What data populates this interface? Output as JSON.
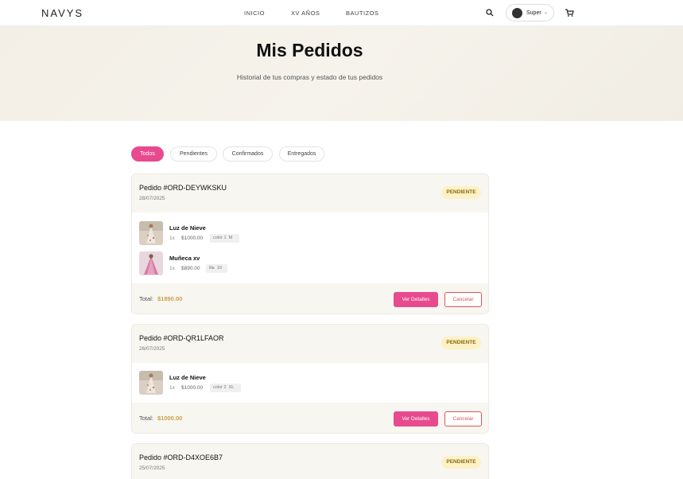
{
  "header": {
    "logo": "NAVYS",
    "logo_extra": "ꟷᵀ ꟷᵀ",
    "nav": [
      {
        "label": "INICIO"
      },
      {
        "label": "XV AÑOS"
      },
      {
        "label": "BAUTIZOS"
      }
    ],
    "user_name": "Super",
    "search_icon": "search-icon",
    "cart_icon": "cart-icon"
  },
  "hero": {
    "title": "Mis Pedidos",
    "subtitle": "Historial de tus compras y estado de tus pedidos"
  },
  "filters": [
    {
      "label": "Todos",
      "active": true
    },
    {
      "label": "Pendientes",
      "active": false
    },
    {
      "label": "Confirmados",
      "active": false
    },
    {
      "label": "Entregados",
      "active": false
    }
  ],
  "colors": {
    "accent": "#e84a8e",
    "badge_bg": "#fdf1c6",
    "badge_text": "#8a6a11",
    "total": "#caa049",
    "cancel": "#e0545a"
  },
  "total_label": "Total:",
  "details_label": "Ver Detalles",
  "cancel_label": "Cancelar",
  "orders": [
    {
      "id": "Pedido #ORD-DEYWKSKU",
      "date": "28/07/2025",
      "status": "PENDIENTE",
      "total": "$1890.00",
      "items": [
        {
          "name": "Luz de Nieve",
          "qty": "1x",
          "price": "$1000.00",
          "color": "color 1",
          "size": "M"
        },
        {
          "name": "Muñeca xv",
          "qty": "1x",
          "price": "$890.00",
          "color": "lila",
          "size": "10"
        }
      ]
    },
    {
      "id": "Pedido #ORD-QR1LFAOR",
      "date": "26/07/2025",
      "status": "PENDIENTE",
      "total": "$1000.00",
      "items": [
        {
          "name": "Luz de Nieve",
          "qty": "1x",
          "price": "$1000.00",
          "color": "color 2",
          "size": "XL"
        }
      ]
    },
    {
      "id": "Pedido #ORD-D4XOE6B7",
      "date": "25/07/2025",
      "status": "PENDIENTE"
    }
  ]
}
